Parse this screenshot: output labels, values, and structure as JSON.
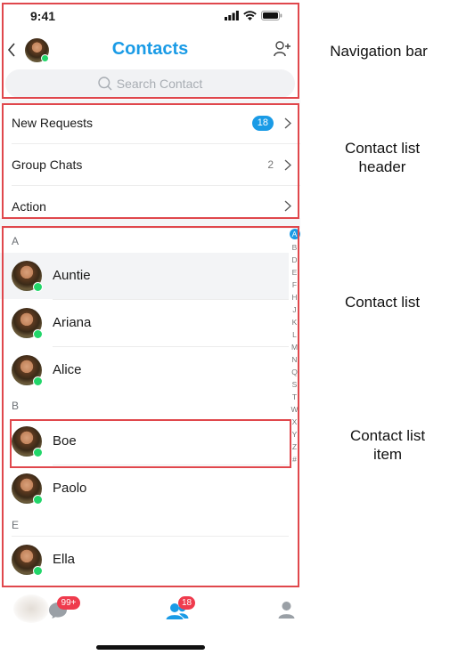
{
  "status_bar": {
    "time": "9:41"
  },
  "nav": {
    "title": "Contacts",
    "search_placeholder": "Search Contact"
  },
  "header_rows": [
    {
      "label": "New Requests",
      "badge": "18"
    },
    {
      "label": "Group Chats",
      "count": "2"
    },
    {
      "label": "Action"
    }
  ],
  "contacts": {
    "section_a": "A",
    "a_items": [
      "Auntie",
      "Ariana",
      "Alice"
    ],
    "section_b": "B",
    "b_items": [
      "Boe",
      "Paolo"
    ],
    "section_e": "E",
    "e_items": [
      "Ella"
    ]
  },
  "index_letters": [
    "A",
    "B",
    "D",
    "E",
    "F",
    "H",
    "J",
    "K",
    "L",
    "M",
    "N",
    "Q",
    "S",
    "T",
    "W",
    "X",
    "Y",
    "Z",
    "#"
  ],
  "tab_bar": {
    "chats_badge": "99+",
    "contacts_badge": "18"
  },
  "annotations": {
    "navigation_bar": "Navigation bar",
    "list_header_line1": "Contact list",
    "list_header_line2": "header",
    "contact_list": "Contact list",
    "list_item_line1": "Contact list",
    "list_item_line2": "item"
  },
  "colors": {
    "accent": "#1a9be6",
    "badge_red": "#ef3b4d",
    "online": "#22d66a",
    "annotation": "#e0474c"
  }
}
